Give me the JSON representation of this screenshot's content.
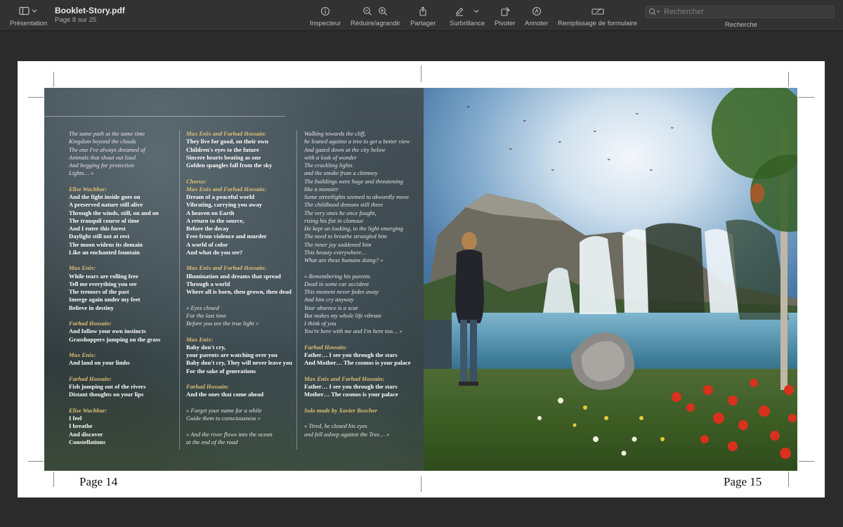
{
  "toolbar": {
    "sidebar_label": "Présentation",
    "doc_title": "Booklet-Story.pdf",
    "doc_subtitle": "Page 8 sur 25",
    "inspector_label": "Inspecteur",
    "zoom_label": "Réduire/agrandir",
    "share_label": "Partager",
    "highlight_label": "Surbrillance",
    "rotate_label": "Pivoter",
    "annotate_label": "Annoter",
    "form_label": "Remplissage de formulaire",
    "search_label": "Recherche",
    "search_placeholder": "Rechercher"
  },
  "icons": {
    "sidebar": "sidebar-icon",
    "inspector": "info-icon",
    "zoom_out": "zoom-out-icon",
    "zoom_in": "zoom-in-icon",
    "share": "share-icon",
    "highlight": "pen-icon",
    "rotate": "rotate-icon",
    "annotate": "annotate-icon",
    "form": "form-icon",
    "search": "search-icon"
  },
  "colors": {
    "speaker": "#e0bf77",
    "toolbar_bg": "#323232",
    "canvas_bg": "#2b2b2b"
  },
  "pages": {
    "left_number": "Page 14",
    "right_number": "Page 15"
  },
  "lyrics": {
    "col1": [
      {
        "t": "The same path at the same time",
        "s": "it"
      },
      {
        "t": "Kingdom beyond the clouds",
        "s": "it"
      },
      {
        "t": "The one I've always dreamed of",
        "s": "it"
      },
      {
        "t": "Animals that shout out loud",
        "s": "it"
      },
      {
        "t": "And begging for protection",
        "s": "it"
      },
      {
        "t": "Lights… »",
        "s": "it"
      },
      {
        "t": "",
        "s": "gap"
      },
      {
        "t": "Elise Wachbar:",
        "s": "sp"
      },
      {
        "t": "And the fight inside goes on",
        "s": "bd"
      },
      {
        "t": "A preserved nature still alive",
        "s": "bd"
      },
      {
        "t": "Through the winds, still, on and on",
        "s": "bd"
      },
      {
        "t": "The tranquil course of time",
        "s": "bd"
      },
      {
        "t": "And I enter this forest",
        "s": "bd"
      },
      {
        "t": "Daylight still not at rest",
        "s": "bd"
      },
      {
        "t": "The moon widens its domain",
        "s": "bd"
      },
      {
        "t": "Like an enchanted fountain",
        "s": "bd"
      },
      {
        "t": "",
        "s": "gap"
      },
      {
        "t": "Max Enix:",
        "s": "sp"
      },
      {
        "t": "While tears are rolling free",
        "s": "bd"
      },
      {
        "t": "Tell me everything you see",
        "s": "bd"
      },
      {
        "t": "The tremors of the past",
        "s": "bd"
      },
      {
        "t": "Imerge again under my feet",
        "s": "bd"
      },
      {
        "t": "Believe in destiny",
        "s": "bd"
      },
      {
        "t": "",
        "s": "gap"
      },
      {
        "t": "Farhad Hossain:",
        "s": "sp"
      },
      {
        "t": "And follow your own instincts",
        "s": "bd"
      },
      {
        "t": "Grasshoppers jumping on the grass",
        "s": "bd"
      },
      {
        "t": "",
        "s": "gap"
      },
      {
        "t": "Max Enix:",
        "s": "sp"
      },
      {
        "t": "And land on your limbs",
        "s": "bd"
      },
      {
        "t": "",
        "s": "gap"
      },
      {
        "t": "Farhad Hossain:",
        "s": "sp"
      },
      {
        "t": "Fish jumping out of the rivers",
        "s": "bd"
      },
      {
        "t": "Distant thoughts on your lips",
        "s": "bd"
      },
      {
        "t": "",
        "s": "gap"
      },
      {
        "t": "Elise Wachbar:",
        "s": "sp"
      },
      {
        "t": "I feel",
        "s": "bd"
      },
      {
        "t": "I breathe",
        "s": "bd"
      },
      {
        "t": "And discover",
        "s": "bd"
      },
      {
        "t": "Constellations",
        "s": "bd"
      }
    ],
    "col2": [
      {
        "t": "Max Enix and Farhad Hossain:",
        "s": "sp"
      },
      {
        "t": "They live for good, on their own",
        "s": "bd"
      },
      {
        "t": "Children's eyes to the future",
        "s": "bd"
      },
      {
        "t": "Sincere hearts beating as one",
        "s": "bd"
      },
      {
        "t": "Golden spangles fall from the sky",
        "s": "bd"
      },
      {
        "t": "",
        "s": "gap"
      },
      {
        "t": "Chorus:",
        "s": "sp"
      },
      {
        "t": "Max Enix and Farhad Hossain:",
        "s": "sp"
      },
      {
        "t": "Dream of a peaceful world",
        "s": "bd"
      },
      {
        "t": "Vibrating, carrying you away",
        "s": "bd"
      },
      {
        "t": "A heaven on Earth",
        "s": "bd"
      },
      {
        "t": "A return to the source,",
        "s": "bd"
      },
      {
        "t": "Before the decay",
        "s": "bd"
      },
      {
        "t": "Free from violence and murder",
        "s": "bd"
      },
      {
        "t": "A world of color",
        "s": "bd"
      },
      {
        "t": "And what do you see?",
        "s": "bd"
      },
      {
        "t": "",
        "s": "gap"
      },
      {
        "t": "Max Enix and Farhad Hossain:",
        "s": "sp"
      },
      {
        "t": "Illumination and dreams that spread",
        "s": "bd"
      },
      {
        "t": "Through a world",
        "s": "bd"
      },
      {
        "t": "Where all is born, then grown, then dead",
        "s": "bd"
      },
      {
        "t": "",
        "s": "gap"
      },
      {
        "t": "« Eyes closed",
        "s": "it"
      },
      {
        "t": "For the last time",
        "s": "it"
      },
      {
        "t": "Before you see the true light »",
        "s": "it"
      },
      {
        "t": "",
        "s": "gap"
      },
      {
        "t": "Max Enix:",
        "s": "sp"
      },
      {
        "t": "Baby don't cry,",
        "s": "bd"
      },
      {
        "t": "your parents are watching over you",
        "s": "bd"
      },
      {
        "t": "Baby don't cry, They will never leave you",
        "s": "bd"
      },
      {
        "t": "For the sake of generations",
        "s": "bd"
      },
      {
        "t": "",
        "s": "gap"
      },
      {
        "t": "Farhad Hossain:",
        "s": "sp"
      },
      {
        "t": "And the ones that come ahead",
        "s": "bd"
      },
      {
        "t": "",
        "s": "gap"
      },
      {
        "t": "« Forget your name for a while",
        "s": "it"
      },
      {
        "t": "Guide them to consciousness »",
        "s": "it"
      },
      {
        "t": "",
        "s": "gap"
      },
      {
        "t": "« And the river flows into the ocean",
        "s": "it"
      },
      {
        "t": "at the end of the road",
        "s": "it"
      }
    ],
    "col3": [
      {
        "t": "Walking towards the cliff,",
        "s": "it"
      },
      {
        "t": "he leaned against a tree to get a better view",
        "s": "it"
      },
      {
        "t": "And gazed down at the city below",
        "s": "it"
      },
      {
        "t": "with a look of wonder",
        "s": "it"
      },
      {
        "t": "The crackling lights",
        "s": "it"
      },
      {
        "t": "and the smoke from a chimney",
        "s": "it"
      },
      {
        "t": "The buildings were huge and threatening",
        "s": "it"
      },
      {
        "t": "like a monster",
        "s": "it"
      },
      {
        "t": "Some streetlights seemed to akwardly move",
        "s": "it"
      },
      {
        "t": "The childhood demons still there",
        "s": "it"
      },
      {
        "t": "The very ones he once fought,",
        "s": "it"
      },
      {
        "t": "rising his fist in clamour",
        "s": "it"
      },
      {
        "t": "He kept on looking, to the light emerging",
        "s": "it"
      },
      {
        "t": "The need to breathe strangled him",
        "s": "it"
      },
      {
        "t": "The inner joy saddened him",
        "s": "it"
      },
      {
        "t": "This beauty everywhere…",
        "s": "it"
      },
      {
        "t": "What are these humans doing? »",
        "s": "it"
      },
      {
        "t": "",
        "s": "gap"
      },
      {
        "t": "« Remembering his parents",
        "s": "it"
      },
      {
        "t": "Dead in some car accident",
        "s": "it"
      },
      {
        "t": "This moment never fades away",
        "s": "it"
      },
      {
        "t": "And him cry anyway",
        "s": "it"
      },
      {
        "t": "Your absence is a scar",
        "s": "it"
      },
      {
        "t": "But makes my whole life vibrate",
        "s": "it"
      },
      {
        "t": "I think of you",
        "s": "it"
      },
      {
        "t": "You're here with me and I'm here too… »",
        "s": "it"
      },
      {
        "t": "",
        "s": "gap"
      },
      {
        "t": "Farhad Hossain:",
        "s": "sp"
      },
      {
        "t": "Father… I see you through the stars",
        "s": "bd"
      },
      {
        "t": "And Mother… The cosmos is your palace",
        "s": "bd"
      },
      {
        "t": "",
        "s": "gap"
      },
      {
        "t": "Max Enix and Farhad Hossain:",
        "s": "sp"
      },
      {
        "t": "Father… I see you through the stars",
        "s": "bd"
      },
      {
        "t": "Mother… The cosmos is your palace",
        "s": "bd"
      },
      {
        "t": "",
        "s": "gap"
      },
      {
        "t": "Solo made by Xavier Boscher",
        "s": "sp"
      },
      {
        "t": "",
        "s": "gap"
      },
      {
        "t": "« Tired, he closed his eyes",
        "s": "it"
      },
      {
        "t": "and fell asleep against the Tree… »",
        "s": "it"
      }
    ]
  }
}
